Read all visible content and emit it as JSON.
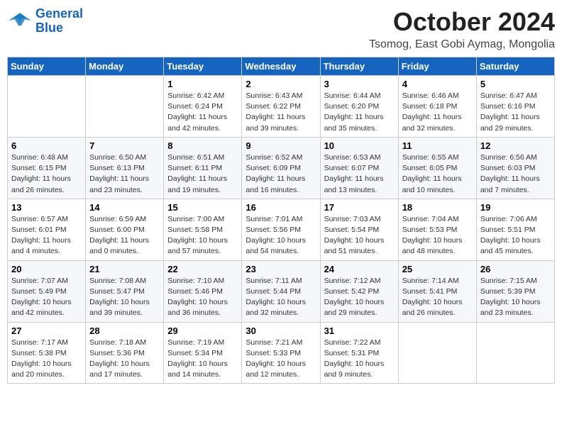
{
  "header": {
    "logo_line1": "General",
    "logo_line2": "Blue",
    "month": "October 2024",
    "location": "Tsomog, East Gobi Aymag, Mongolia"
  },
  "days_of_week": [
    "Sunday",
    "Monday",
    "Tuesday",
    "Wednesday",
    "Thursday",
    "Friday",
    "Saturday"
  ],
  "weeks": [
    [
      {
        "day": "",
        "sunrise": "",
        "sunset": "",
        "daylight": ""
      },
      {
        "day": "",
        "sunrise": "",
        "sunset": "",
        "daylight": ""
      },
      {
        "day": "1",
        "sunrise": "Sunrise: 6:42 AM",
        "sunset": "Sunset: 6:24 PM",
        "daylight": "Daylight: 11 hours and 42 minutes."
      },
      {
        "day": "2",
        "sunrise": "Sunrise: 6:43 AM",
        "sunset": "Sunset: 6:22 PM",
        "daylight": "Daylight: 11 hours and 39 minutes."
      },
      {
        "day": "3",
        "sunrise": "Sunrise: 6:44 AM",
        "sunset": "Sunset: 6:20 PM",
        "daylight": "Daylight: 11 hours and 35 minutes."
      },
      {
        "day": "4",
        "sunrise": "Sunrise: 6:46 AM",
        "sunset": "Sunset: 6:18 PM",
        "daylight": "Daylight: 11 hours and 32 minutes."
      },
      {
        "day": "5",
        "sunrise": "Sunrise: 6:47 AM",
        "sunset": "Sunset: 6:16 PM",
        "daylight": "Daylight: 11 hours and 29 minutes."
      }
    ],
    [
      {
        "day": "6",
        "sunrise": "Sunrise: 6:48 AM",
        "sunset": "Sunset: 6:15 PM",
        "daylight": "Daylight: 11 hours and 26 minutes."
      },
      {
        "day": "7",
        "sunrise": "Sunrise: 6:50 AM",
        "sunset": "Sunset: 6:13 PM",
        "daylight": "Daylight: 11 hours and 23 minutes."
      },
      {
        "day": "8",
        "sunrise": "Sunrise: 6:51 AM",
        "sunset": "Sunset: 6:11 PM",
        "daylight": "Daylight: 11 hours and 19 minutes."
      },
      {
        "day": "9",
        "sunrise": "Sunrise: 6:52 AM",
        "sunset": "Sunset: 6:09 PM",
        "daylight": "Daylight: 11 hours and 16 minutes."
      },
      {
        "day": "10",
        "sunrise": "Sunrise: 6:53 AM",
        "sunset": "Sunset: 6:07 PM",
        "daylight": "Daylight: 11 hours and 13 minutes."
      },
      {
        "day": "11",
        "sunrise": "Sunrise: 6:55 AM",
        "sunset": "Sunset: 6:05 PM",
        "daylight": "Daylight: 11 hours and 10 minutes."
      },
      {
        "day": "12",
        "sunrise": "Sunrise: 6:56 AM",
        "sunset": "Sunset: 6:03 PM",
        "daylight": "Daylight: 11 hours and 7 minutes."
      }
    ],
    [
      {
        "day": "13",
        "sunrise": "Sunrise: 6:57 AM",
        "sunset": "Sunset: 6:01 PM",
        "daylight": "Daylight: 11 hours and 4 minutes."
      },
      {
        "day": "14",
        "sunrise": "Sunrise: 6:59 AM",
        "sunset": "Sunset: 6:00 PM",
        "daylight": "Daylight: 11 hours and 0 minutes."
      },
      {
        "day": "15",
        "sunrise": "Sunrise: 7:00 AM",
        "sunset": "Sunset: 5:58 PM",
        "daylight": "Daylight: 10 hours and 57 minutes."
      },
      {
        "day": "16",
        "sunrise": "Sunrise: 7:01 AM",
        "sunset": "Sunset: 5:56 PM",
        "daylight": "Daylight: 10 hours and 54 minutes."
      },
      {
        "day": "17",
        "sunrise": "Sunrise: 7:03 AM",
        "sunset": "Sunset: 5:54 PM",
        "daylight": "Daylight: 10 hours and 51 minutes."
      },
      {
        "day": "18",
        "sunrise": "Sunrise: 7:04 AM",
        "sunset": "Sunset: 5:53 PM",
        "daylight": "Daylight: 10 hours and 48 minutes."
      },
      {
        "day": "19",
        "sunrise": "Sunrise: 7:06 AM",
        "sunset": "Sunset: 5:51 PM",
        "daylight": "Daylight: 10 hours and 45 minutes."
      }
    ],
    [
      {
        "day": "20",
        "sunrise": "Sunrise: 7:07 AM",
        "sunset": "Sunset: 5:49 PM",
        "daylight": "Daylight: 10 hours and 42 minutes."
      },
      {
        "day": "21",
        "sunrise": "Sunrise: 7:08 AM",
        "sunset": "Sunset: 5:47 PM",
        "daylight": "Daylight: 10 hours and 39 minutes."
      },
      {
        "day": "22",
        "sunrise": "Sunrise: 7:10 AM",
        "sunset": "Sunset: 5:46 PM",
        "daylight": "Daylight: 10 hours and 36 minutes."
      },
      {
        "day": "23",
        "sunrise": "Sunrise: 7:11 AM",
        "sunset": "Sunset: 5:44 PM",
        "daylight": "Daylight: 10 hours and 32 minutes."
      },
      {
        "day": "24",
        "sunrise": "Sunrise: 7:12 AM",
        "sunset": "Sunset: 5:42 PM",
        "daylight": "Daylight: 10 hours and 29 minutes."
      },
      {
        "day": "25",
        "sunrise": "Sunrise: 7:14 AM",
        "sunset": "Sunset: 5:41 PM",
        "daylight": "Daylight: 10 hours and 26 minutes."
      },
      {
        "day": "26",
        "sunrise": "Sunrise: 7:15 AM",
        "sunset": "Sunset: 5:39 PM",
        "daylight": "Daylight: 10 hours and 23 minutes."
      }
    ],
    [
      {
        "day": "27",
        "sunrise": "Sunrise: 7:17 AM",
        "sunset": "Sunset: 5:38 PM",
        "daylight": "Daylight: 10 hours and 20 minutes."
      },
      {
        "day": "28",
        "sunrise": "Sunrise: 7:18 AM",
        "sunset": "Sunset: 5:36 PM",
        "daylight": "Daylight: 10 hours and 17 minutes."
      },
      {
        "day": "29",
        "sunrise": "Sunrise: 7:19 AM",
        "sunset": "Sunset: 5:34 PM",
        "daylight": "Daylight: 10 hours and 14 minutes."
      },
      {
        "day": "30",
        "sunrise": "Sunrise: 7:21 AM",
        "sunset": "Sunset: 5:33 PM",
        "daylight": "Daylight: 10 hours and 12 minutes."
      },
      {
        "day": "31",
        "sunrise": "Sunrise: 7:22 AM",
        "sunset": "Sunset: 5:31 PM",
        "daylight": "Daylight: 10 hours and 9 minutes."
      },
      {
        "day": "",
        "sunrise": "",
        "sunset": "",
        "daylight": ""
      },
      {
        "day": "",
        "sunrise": "",
        "sunset": "",
        "daylight": ""
      }
    ]
  ]
}
